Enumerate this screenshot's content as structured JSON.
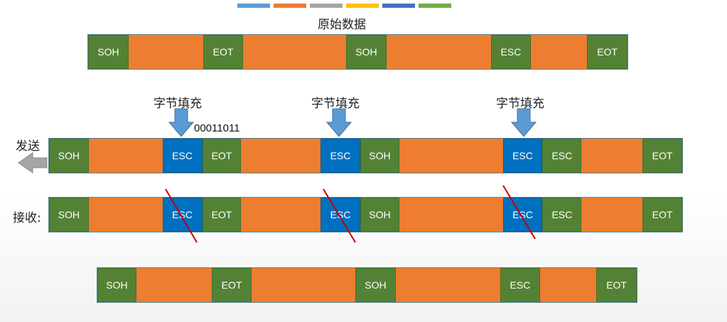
{
  "top_bar_colors": [
    "#5b9bd5",
    "#ed7d31",
    "#a5a5a5",
    "#ffc000",
    "#4472c4",
    "#70ad47"
  ],
  "title": "原始数据",
  "stuffing_label": "字节填充",
  "send_label": "发送",
  "receive_label": "接收:",
  "esc_code": "00011011",
  "colors": {
    "control": "#548235",
    "data": "#ed7d31",
    "escape": "#0070c0",
    "arrow": "#5b9bd5",
    "strike": "#c00000"
  },
  "rows": {
    "original": [
      "SOH",
      "",
      "EOT",
      "",
      "SOH",
      "",
      "ESC",
      "",
      "EOT"
    ],
    "send": [
      "SOH",
      "",
      "ESC",
      "EOT",
      "",
      "ESC",
      "SOH",
      "",
      "ESC",
      "ESC",
      "",
      "EOT"
    ],
    "receive": [
      "SOH",
      "",
      "ESC",
      "EOT",
      "",
      "ESC",
      "SOH",
      "",
      "ESC",
      "ESC",
      "",
      "EOT"
    ],
    "result": [
      "SOH",
      "",
      "EOT",
      "",
      "SOH",
      "",
      "ESC",
      "",
      "EOT"
    ]
  }
}
